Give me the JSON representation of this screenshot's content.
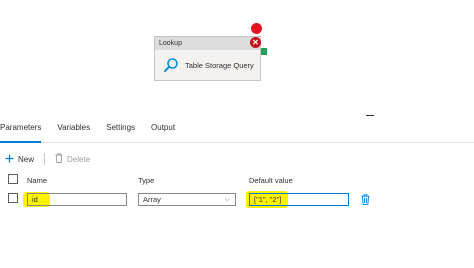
{
  "canvas": {
    "activity": {
      "type_label": "Lookup",
      "name": "Table Storage Query",
      "icon": "magnifier-icon"
    },
    "status_icons": [
      "error-icon",
      "success-handle"
    ],
    "colors": {
      "error": "#c50f1f",
      "success": "#22a05a",
      "accent": "#0078d4"
    }
  },
  "tabs": [
    {
      "label": "Parameters",
      "active": true
    },
    {
      "label": "Variables",
      "active": false
    },
    {
      "label": "Settings",
      "active": false
    },
    {
      "label": "Output",
      "active": false
    }
  ],
  "toolbar": {
    "new_label": "New",
    "delete_label": "Delete"
  },
  "table": {
    "columns": [
      "Name",
      "Type",
      "Default value"
    ],
    "rows": [
      {
        "name": "id",
        "type": "Array",
        "default_value": "[\"1\", \"2\"]"
      }
    ]
  },
  "highlight_color": "#fff200"
}
